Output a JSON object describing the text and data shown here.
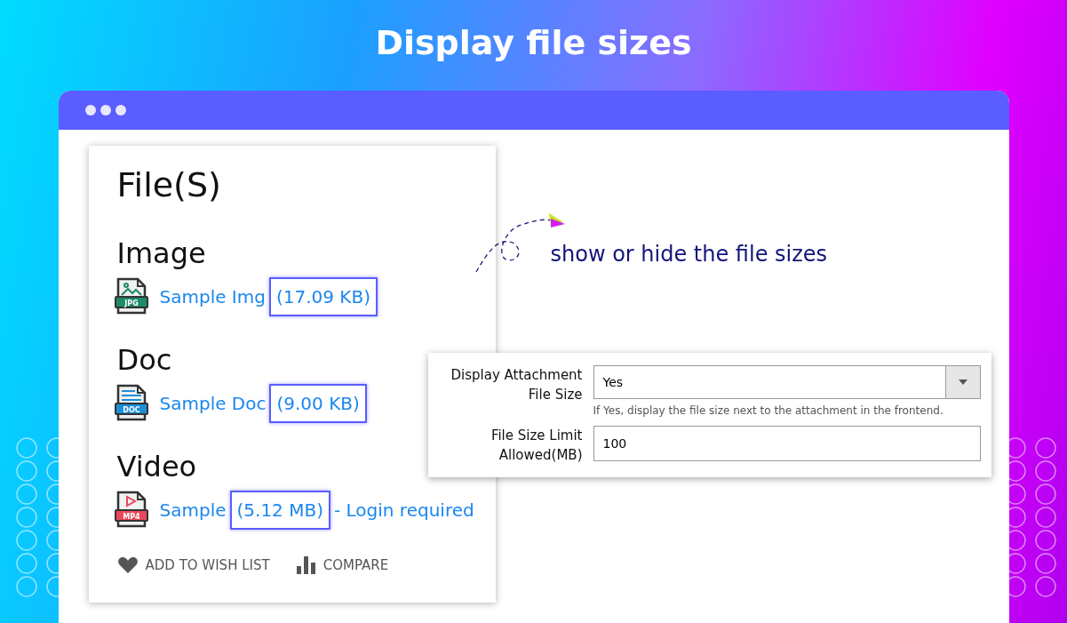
{
  "banner": {
    "title": "Display file sizes"
  },
  "card": {
    "title": "File(S)",
    "sections": [
      {
        "heading": "Image",
        "kind": "image",
        "badge": "JPG",
        "link": "Sample Img",
        "size": "(17.09 KB)"
      },
      {
        "heading": "Doc",
        "kind": "doc",
        "badge": "DOC",
        "link": "Sample Doc",
        "size": "(9.00 KB)"
      },
      {
        "heading": "Video",
        "kind": "video",
        "badge": "MP4",
        "link": "Sample",
        "size": "(5.12 MB)",
        "suffix": "- Login required"
      }
    ],
    "actions": [
      {
        "kind": "wishlist",
        "label": "ADD TO WISH LIST"
      },
      {
        "kind": "compare",
        "label": "COMPARE"
      }
    ]
  },
  "annotation": {
    "text": "show or hide the file sizes"
  },
  "settings": {
    "fields": [
      {
        "kind": "select",
        "label": "Display Attachment File Size",
        "value": "Yes",
        "hint": "If Yes, display the file size next to the attachment in the frontend."
      },
      {
        "kind": "text",
        "label": "File Size Limit Allowed(MB)",
        "value": "100"
      }
    ]
  }
}
